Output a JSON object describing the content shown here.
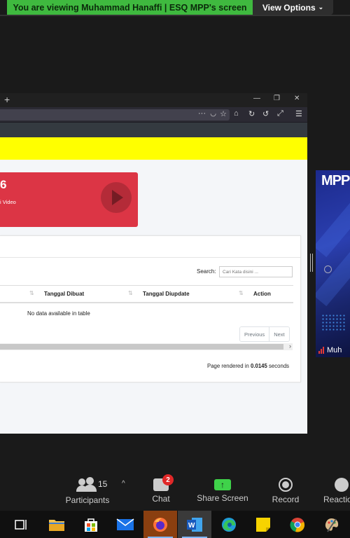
{
  "share_banner": {
    "text": "You are viewing Muhammad Hanaffi | ESQ MPP's screen",
    "view_options": "View Options"
  },
  "browser": {
    "card": {
      "count": "6",
      "label": "i Video"
    },
    "table": {
      "search_label": "Search:",
      "search_placeholder": "Cari Kata disini ...",
      "columns": [
        "Tanggal Dibuat",
        "Tanggal Diupdate",
        "Action"
      ],
      "empty_message": "No data available in table",
      "prev_label": "Previous",
      "next_label": "Next"
    },
    "footer": {
      "prefix": "Page rendered in ",
      "time": "0.0145",
      "suffix": " seconds"
    }
  },
  "video_tile": {
    "logo_text": "MPP",
    "name": "Muh"
  },
  "controls": {
    "participants_label": "Participants",
    "participants_count": "15",
    "chat_label": "Chat",
    "chat_badge": "2",
    "share_label": "Share Screen",
    "record_label": "Record",
    "reactions_label": "Reactio"
  },
  "colors": {
    "banner_green": "#3fb93f",
    "highlight_yellow": "#ffff00",
    "card_red": "#dc3545",
    "share_green": "#3fd24a"
  }
}
